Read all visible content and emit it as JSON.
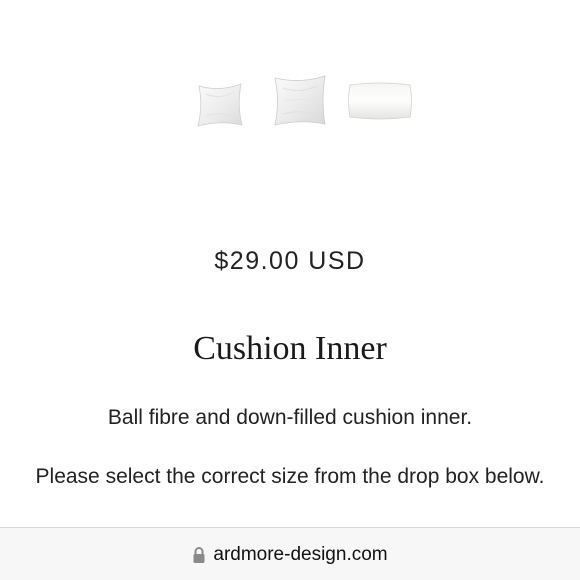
{
  "product": {
    "images": [
      {
        "name": "square cushion inner small"
      },
      {
        "name": "square cushion inner large"
      },
      {
        "name": "rectangular cushion inner"
      }
    ],
    "price": "$29.00 USD",
    "title": "Cushion Inner",
    "description": "Ball fibre and down-filled cushion inner.",
    "instruction": "Please select the correct size from the drop box below."
  },
  "browser": {
    "url": "ardmore-design.com",
    "lock_icon": "lock-icon"
  }
}
